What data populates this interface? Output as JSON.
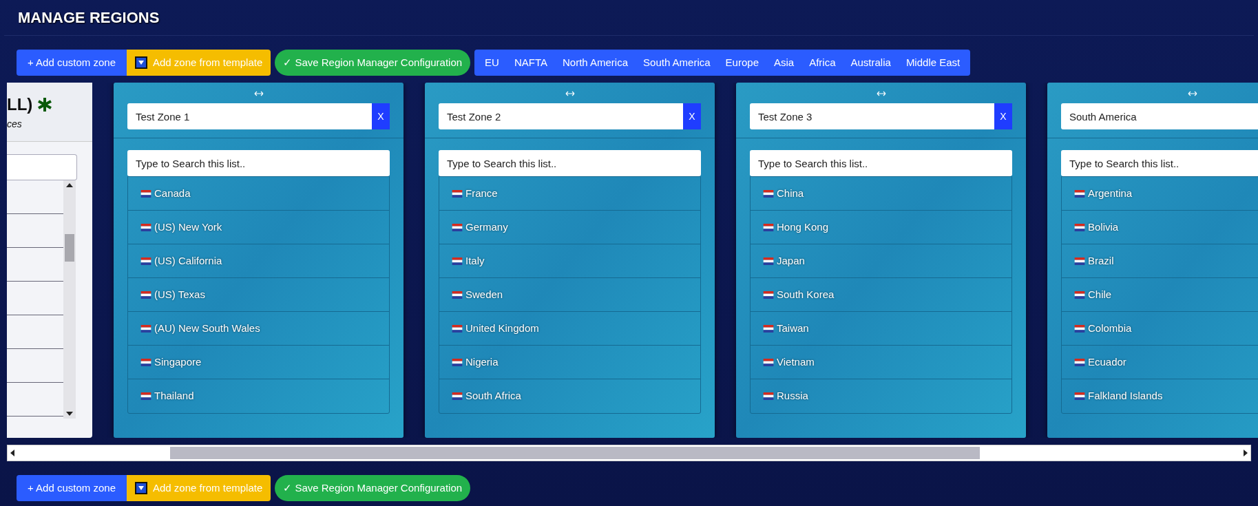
{
  "page_title": "MANAGE REGIONS",
  "toolbar": {
    "add_custom": "+ Add custom zone",
    "add_template": "Add zone from template",
    "save": "✓ Save Region Manager Configuration",
    "templates": [
      "EU",
      "NAFTA",
      "North America",
      "South America",
      "Europe",
      "Asia",
      "Africa",
      "Australia",
      "Middle East"
    ]
  },
  "side_panel": {
    "title": "LL)",
    "subtitle": "ces"
  },
  "zones": [
    {
      "name": "Test Zone 1",
      "remove": "X",
      "search_placeholder": "Type to Search this list..",
      "items": [
        "Canada",
        "(US) New York",
        "(US) California",
        "(US) Texas",
        "(AU) New South Wales",
        "Singapore",
        "Thailand"
      ]
    },
    {
      "name": "Test Zone 2",
      "remove": "X",
      "search_placeholder": "Type to Search this list..",
      "items": [
        "France",
        "Germany",
        "Italy",
        "Sweden",
        "United Kingdom",
        "Nigeria",
        "South Africa"
      ]
    },
    {
      "name": "Test Zone 3",
      "remove": "X",
      "search_placeholder": "Type to Search this list..",
      "items": [
        "China",
        "Hong Kong",
        "Japan",
        "South Korea",
        "Taiwan",
        "Vietnam",
        "Russia"
      ]
    },
    {
      "name": "South America",
      "search_placeholder": "Type to Search this list..",
      "items": [
        "Argentina",
        "Bolivia",
        "Brazil",
        "Chile",
        "Colombia",
        "Ecuador",
        "Falkland Islands"
      ]
    }
  ],
  "bottom_toolbar": {
    "add_custom": "+ Add custom zone",
    "add_template": "Add zone from template",
    "save": "✓ Save Region Manager Configuration"
  }
}
